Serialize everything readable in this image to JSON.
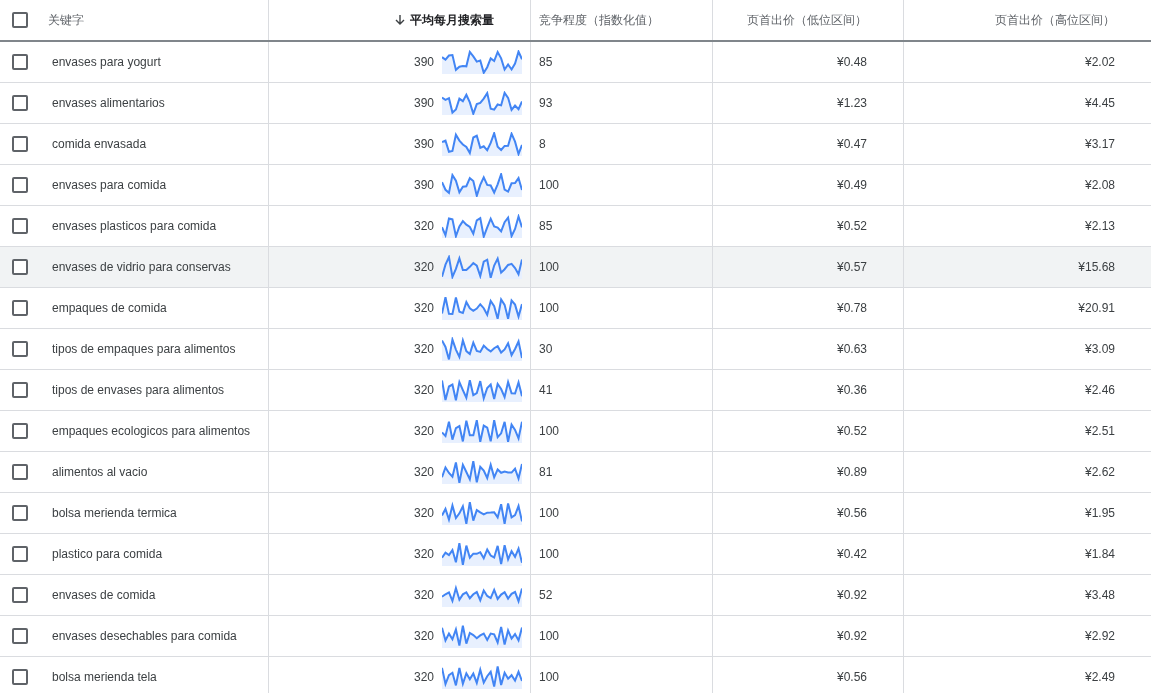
{
  "table": {
    "columns": [
      {
        "label": "关键字",
        "sorted": false
      },
      {
        "label": "平均每月搜索量",
        "sorted": true
      },
      {
        "label": "竞争程度（指数化值）",
        "sorted": false
      },
      {
        "label": "页首出价（低位区间）",
        "sorted": false
      },
      {
        "label": "页首出价（高位区间）",
        "sorted": false
      }
    ],
    "header_checked": false,
    "rows": [
      {
        "checked": false,
        "hovered": false,
        "keyword": "envases para yogurt",
        "searches": "390",
        "competition": "85",
        "low_bid": "¥0.48",
        "high_bid": "¥2.02"
      },
      {
        "checked": false,
        "hovered": false,
        "keyword": "envases alimentarios",
        "searches": "390",
        "competition": "93",
        "low_bid": "¥1.23",
        "high_bid": "¥4.45"
      },
      {
        "checked": false,
        "hovered": false,
        "keyword": "comida envasada",
        "searches": "390",
        "competition": "8",
        "low_bid": "¥0.47",
        "high_bid": "¥3.17"
      },
      {
        "checked": false,
        "hovered": false,
        "keyword": "envases para comida",
        "searches": "390",
        "competition": "100",
        "low_bid": "¥0.49",
        "high_bid": "¥2.08"
      },
      {
        "checked": false,
        "hovered": false,
        "keyword": "envases plasticos para comida",
        "searches": "320",
        "competition": "85",
        "low_bid": "¥0.52",
        "high_bid": "¥2.13"
      },
      {
        "checked": false,
        "hovered": true,
        "keyword": "envases de vidrio para conservas",
        "searches": "320",
        "competition": "100",
        "low_bid": "¥0.57",
        "high_bid": "¥15.68"
      },
      {
        "checked": false,
        "hovered": false,
        "keyword": "empaques de comida",
        "searches": "320",
        "competition": "100",
        "low_bid": "¥0.78",
        "high_bid": "¥20.91"
      },
      {
        "checked": false,
        "hovered": false,
        "keyword": "tipos de empaques para alimentos",
        "searches": "320",
        "competition": "30",
        "low_bid": "¥0.63",
        "high_bid": "¥3.09"
      },
      {
        "checked": false,
        "hovered": false,
        "keyword": "tipos de envases para alimentos",
        "searches": "320",
        "competition": "41",
        "low_bid": "¥0.36",
        "high_bid": "¥2.46"
      },
      {
        "checked": false,
        "hovered": false,
        "keyword": "empaques ecologicos para alimentos",
        "searches": "320",
        "competition": "100",
        "low_bid": "¥0.52",
        "high_bid": "¥2.51"
      },
      {
        "checked": false,
        "hovered": false,
        "keyword": "alimentos al vacio",
        "searches": "320",
        "competition": "81",
        "low_bid": "¥0.89",
        "high_bid": "¥2.62"
      },
      {
        "checked": false,
        "hovered": false,
        "keyword": "bolsa merienda termica",
        "searches": "320",
        "competition": "100",
        "low_bid": "¥0.56",
        "high_bid": "¥1.95"
      },
      {
        "checked": false,
        "hovered": false,
        "keyword": "plastico para comida",
        "searches": "320",
        "competition": "100",
        "low_bid": "¥0.42",
        "high_bid": "¥1.84"
      },
      {
        "checked": false,
        "hovered": false,
        "keyword": "envases de comida",
        "searches": "320",
        "competition": "52",
        "low_bid": "¥0.92",
        "high_bid": "¥3.48"
      },
      {
        "checked": false,
        "hovered": false,
        "keyword": "envases desechables para comida",
        "searches": "320",
        "competition": "100",
        "low_bid": "¥0.92",
        "high_bid": "¥2.92"
      },
      {
        "checked": false,
        "hovered": false,
        "keyword": "bolsa merienda tela",
        "searches": "320",
        "competition": "100",
        "low_bid": "¥0.56",
        "high_bid": "¥2.49"
      }
    ]
  }
}
